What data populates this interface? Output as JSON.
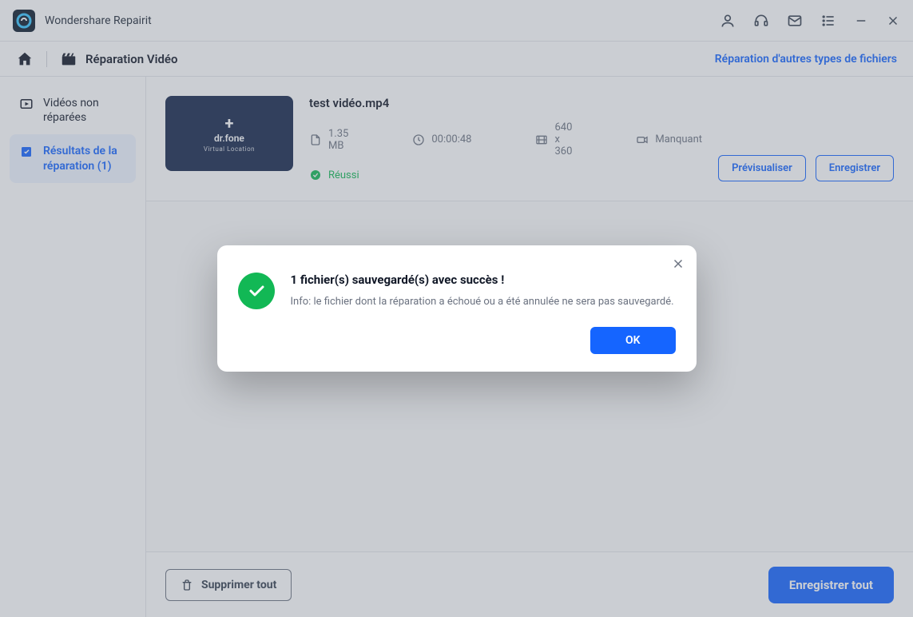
{
  "titlebar": {
    "app_name": "Wondershare Repairit"
  },
  "breadcrumb": {
    "section": "Réparation Vidéo",
    "other_link": "Réparation d'autres types de fichiers"
  },
  "sidebar": {
    "items": [
      {
        "label": "Vidéos non réparées"
      },
      {
        "label": "Résultats de la réparation (1)"
      }
    ]
  },
  "file": {
    "name": "test vidéo.mp4",
    "size": "1.35  MB",
    "duration": "00:00:48",
    "resolution": "640 x 360",
    "camera": "Manquant",
    "status": "Réussi",
    "thumb_line1": "dr.fone",
    "thumb_line2": "Virtual Location"
  },
  "actions": {
    "preview": "Prévisualiser",
    "save": "Enregistrer",
    "delete_all": "Supprimer tout",
    "save_all": "Enregistrer tout"
  },
  "dialog": {
    "title": "1 fichier(s) sauvegardé(s) avec succès !",
    "info": "Info: le fichier dont la réparation a échoué ou a été annulée ne sera pas sauvegardé.",
    "ok": "OK"
  }
}
